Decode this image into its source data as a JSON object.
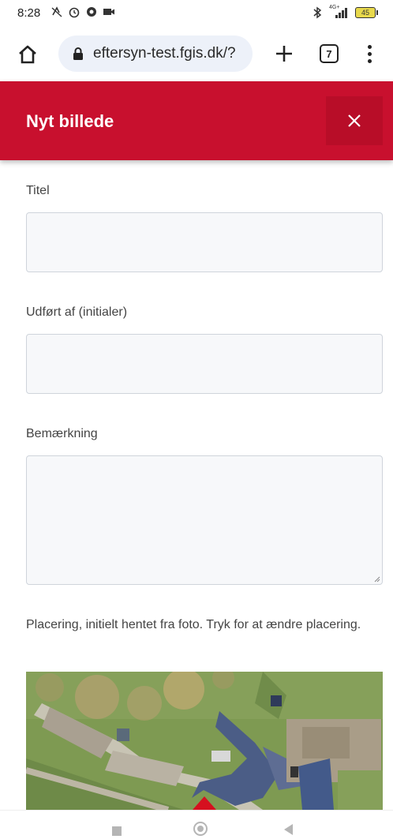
{
  "status_bar": {
    "time": "8:28",
    "network": "4G+",
    "battery": "45"
  },
  "browser": {
    "url": "eftersyn-test.fgis.dk/?",
    "tab_count": "7"
  },
  "header": {
    "title": "Nyt billede",
    "close_label": "✕",
    "accent_color": "#c8102e"
  },
  "form": {
    "title_label": "Titel",
    "title_value": "",
    "initials_label": "Udført af (initialer)",
    "initials_value": "",
    "remark_label": "Bemærkning",
    "remark_value": "",
    "placement_text": "Placering, initielt hentet fra foto. Tryk for at ændre placering."
  },
  "icons": {
    "home": "home-icon",
    "lock": "lock-icon",
    "new_tab": "plus-icon",
    "menu": "more-vert-icon",
    "close": "close-icon",
    "map_marker": "location-marker-icon"
  }
}
